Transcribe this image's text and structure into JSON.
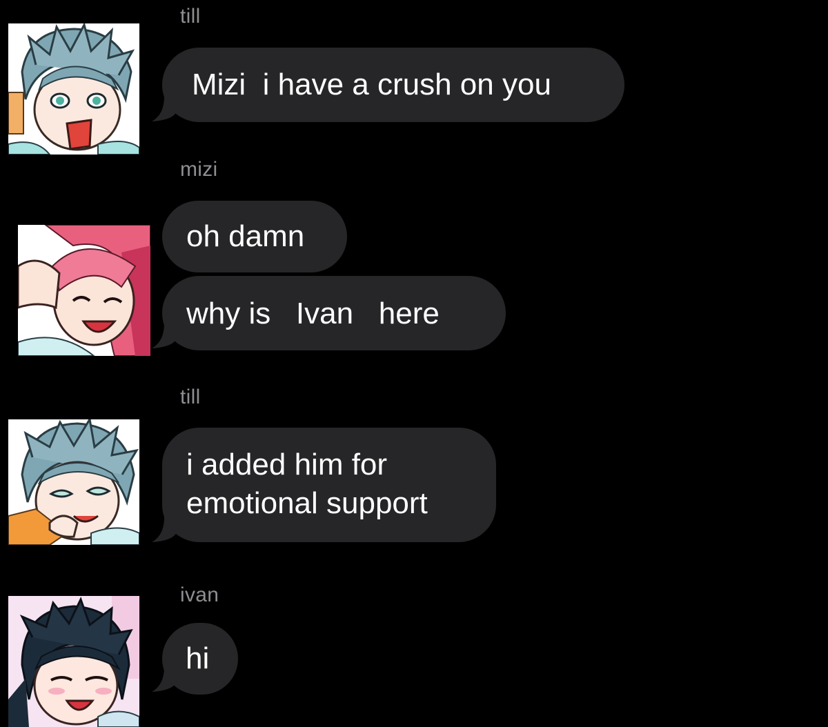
{
  "colors": {
    "background": "#000000",
    "bubble": "#262629",
    "bubble_text": "#ffffff",
    "sender_label": "#8e8e93"
  },
  "messages": [
    {
      "sender": "till",
      "bubbles": [
        "Mizi  i have a crush on you"
      ]
    },
    {
      "sender": "mizi",
      "bubbles": [
        "oh damn",
        "why is   Ivan   here"
      ]
    },
    {
      "sender": "till",
      "bubbles": [
        "i added him for\nemotional support"
      ]
    },
    {
      "sender": "ivan",
      "bubbles": [
        "hi"
      ]
    }
  ],
  "avatars": [
    {
      "icon": "avatar-till-shocked"
    },
    {
      "icon": "avatar-mizi-laughing"
    },
    {
      "icon": "avatar-till-smirking"
    },
    {
      "icon": "avatar-ivan-smiling"
    }
  ]
}
